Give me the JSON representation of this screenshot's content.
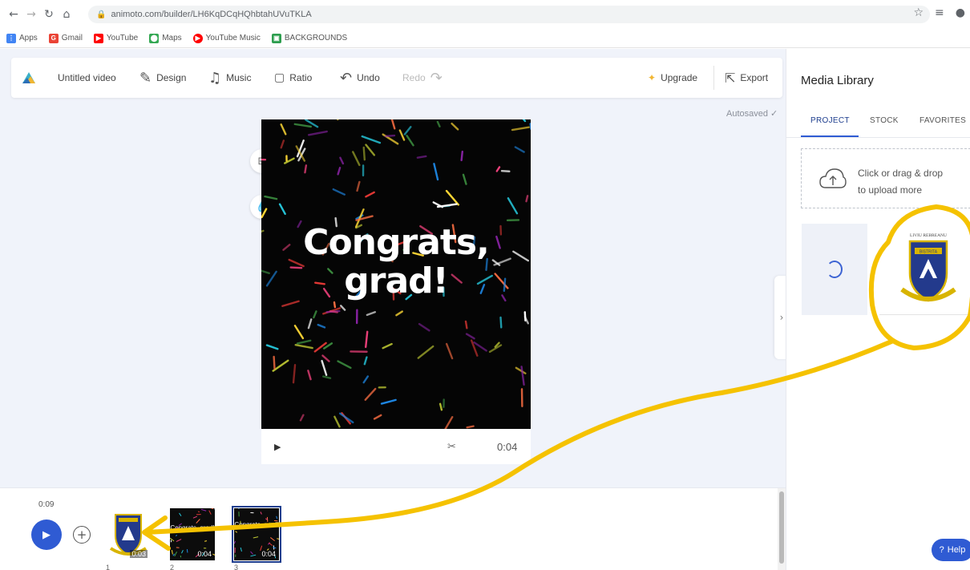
{
  "browser": {
    "url": "animoto.com/builder/LH6KqDCqHQhbtahUVuTKLA",
    "bookmarks": [
      {
        "label": "Apps",
        "icon": "apps-grid-icon",
        "color": "#4285f4"
      },
      {
        "label": "Gmail",
        "icon": "gmail-icon",
        "color": "#ea4335"
      },
      {
        "label": "YouTube",
        "icon": "youtube-icon",
        "color": "#ff0000"
      },
      {
        "label": "Maps",
        "icon": "maps-pin-icon",
        "color": "#34a853"
      },
      {
        "label": "YouTube Music",
        "icon": "youtube-music-icon",
        "color": "#ff0000"
      },
      {
        "label": "BACKGROUNDS",
        "icon": "folder-icon",
        "color": "#2e9e4f"
      }
    ]
  },
  "toolbar": {
    "title": "Untitled video",
    "design": "Design",
    "music": "Music",
    "ratio": "Ratio",
    "undo": "Undo",
    "redo": "Redo",
    "upgrade": "Upgrade",
    "export": "Export",
    "autosaved": "Autosaved ✓"
  },
  "preview": {
    "headline_line1": "Congrats,",
    "headline_line2": "grad!",
    "duration": "0:04"
  },
  "timeline": {
    "total_time": "0:09",
    "clips": [
      {
        "number": "1",
        "duration": "0:03",
        "caption": "",
        "selected": false
      },
      {
        "number": "2",
        "duration": "0:04",
        "caption": "Congrats, grad!",
        "selected": false
      },
      {
        "number": "3",
        "duration": "0:04",
        "caption": "Congrats, grad!",
        "selected": true
      }
    ]
  },
  "library": {
    "title": "Media Library",
    "tabs": [
      "PROJECT",
      "STOCK",
      "FAVORITES"
    ],
    "active_tab": "PROJECT",
    "upload_line1": "Click or drag & drop",
    "upload_line2": "to upload more",
    "logo_caption": "LIVIU REBREANU",
    "logo_banner": "BISTRITA",
    "help": "Help"
  },
  "colors": {
    "accent": "#2f5bd3",
    "annotation": "#f5c200",
    "canvas": "#050505"
  }
}
